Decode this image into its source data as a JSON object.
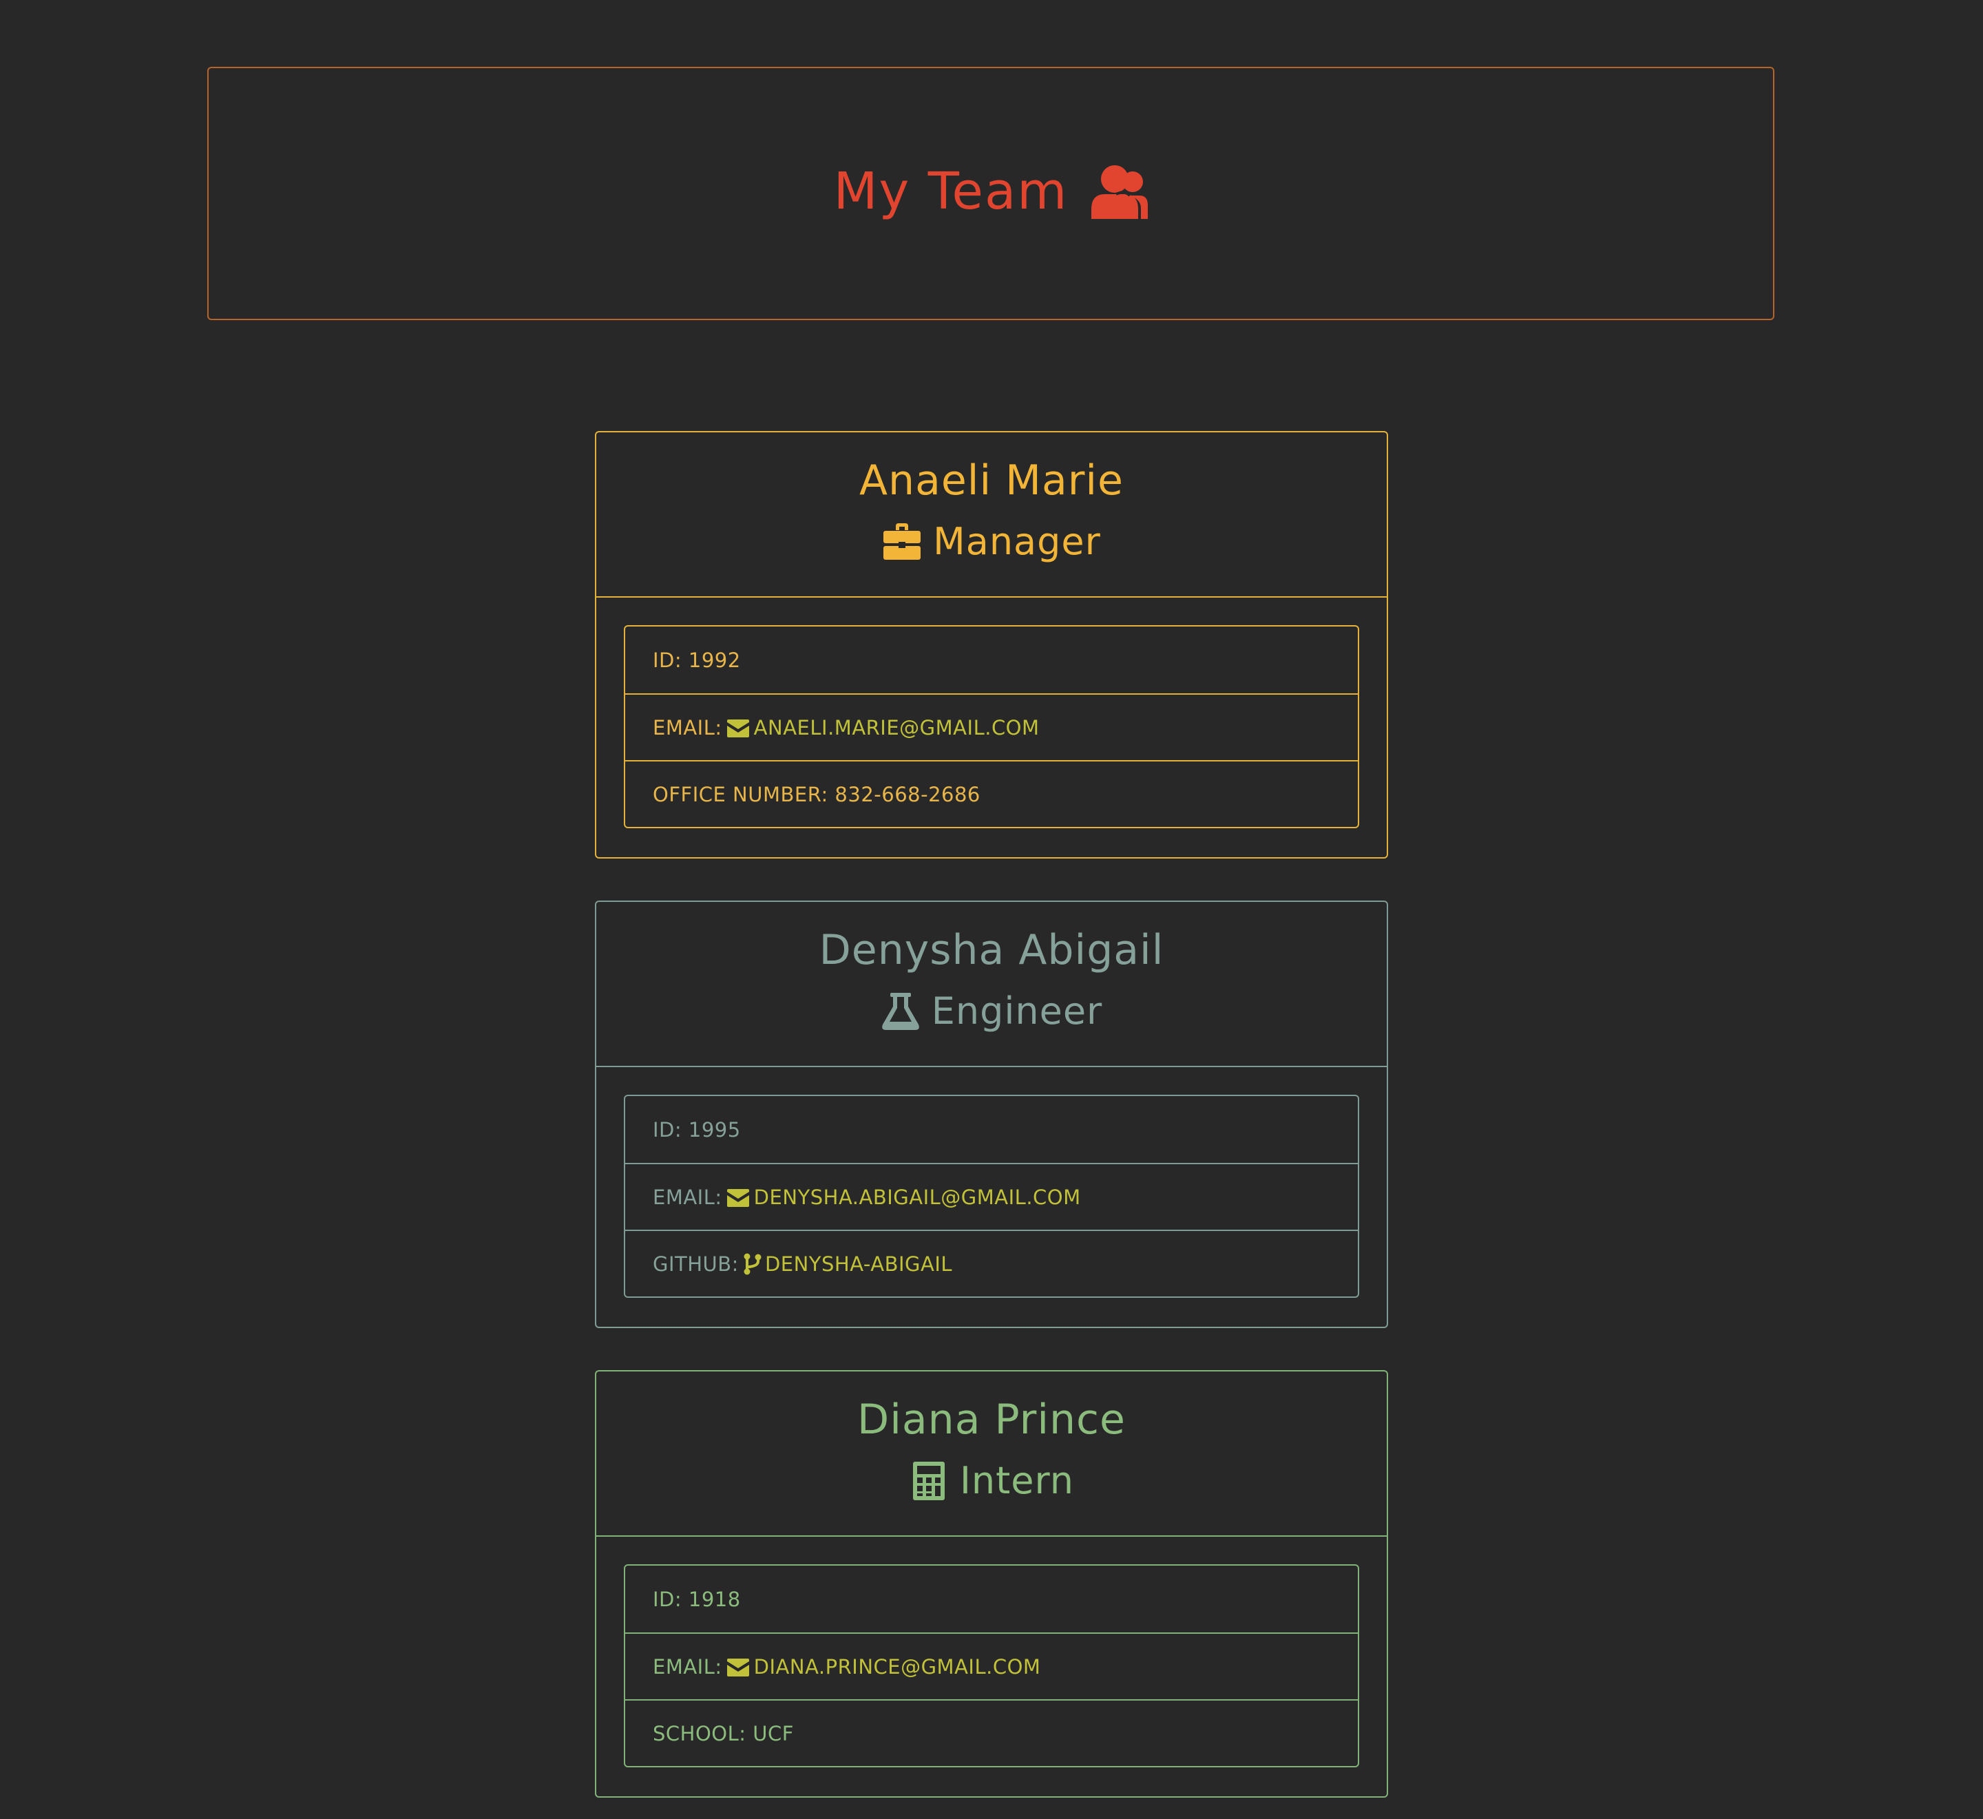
{
  "header": {
    "title": "My Team",
    "icon": "users-icon",
    "color": "#e2452f"
  },
  "team": [
    {
      "name": "Anaeli Marie",
      "role": "Manager",
      "role_icon": "briefcase-icon",
      "id_label": "ID: 1992",
      "email_label": "EMAIL:",
      "email": "ANAELI.MARIE@GMAIL.COM",
      "extra_label": "OFFICE NUMBER: 832-668-2686",
      "color": "#f2b538"
    },
    {
      "name": "Denysha Abigail",
      "role": "Engineer",
      "role_icon": "flask-icon",
      "id_label": "ID: 1995",
      "email_label": "EMAIL:",
      "email": "DENYSHA.ABIGAIL@GMAIL.COM",
      "extra_label": "GITHUB:",
      "github": "DENYSHA-ABIGAIL",
      "color": "#86a09a"
    },
    {
      "name": "Diana Prince",
      "role": "Intern",
      "role_icon": "calculator-icon",
      "id_label": "ID: 1918",
      "email_label": "EMAIL:",
      "email": "DIANA.PRINCE@GMAIL.COM",
      "extra_label": "SCHOOL: UCF",
      "color": "#8cbc7d"
    }
  ],
  "link_color": "#c2c23a"
}
